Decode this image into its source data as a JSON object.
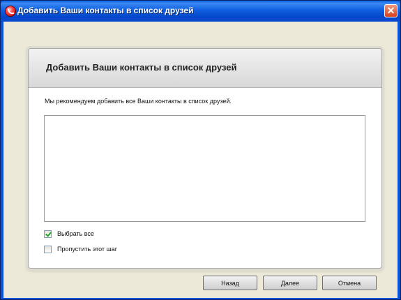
{
  "window": {
    "title": "Добавить Ваши контакты в список друзей",
    "close_glyph": "✕",
    "icon": "app-logo-icon",
    "close_icon": "close-icon"
  },
  "card": {
    "title": "Добавить Ваши контакты в список друзей",
    "description": "Мы рекомендуем добавить все Ваши контакты в список друзей.",
    "contacts": []
  },
  "options": {
    "select_all": {
      "label": "Выбрать все",
      "checked": true
    },
    "skip_step": {
      "label": "Пропустить этот шаг",
      "checked": false
    }
  },
  "buttons": {
    "back": "Назад",
    "next": "Далее",
    "cancel": "Отмена"
  },
  "colors": {
    "titlebar": "#0b5ce0",
    "client_background": "#ece9d8",
    "checkmark": "#21a121",
    "close_button": "#d5401d"
  }
}
